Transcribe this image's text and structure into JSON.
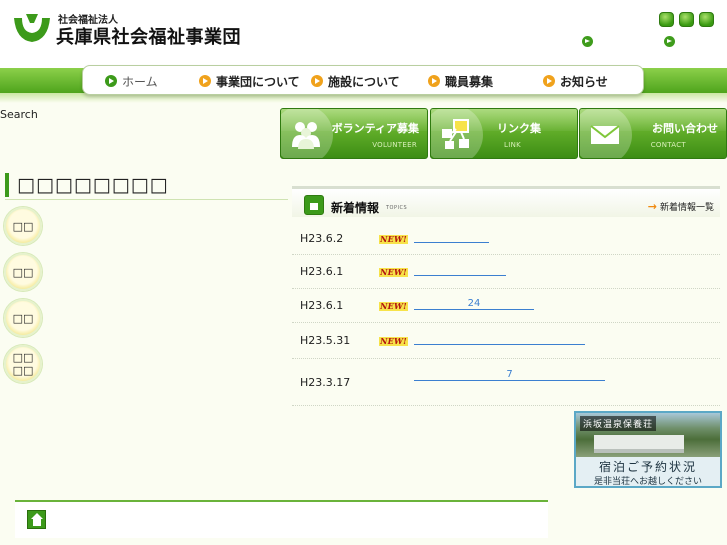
{
  "header": {
    "org_sub": "社会福祉法人",
    "org_name": "兵庫県社会福祉事業団",
    "brand_color": "#3c9a1a"
  },
  "nav": {
    "items": [
      {
        "label": "ホーム",
        "icon": "green-arrow-icon"
      },
      {
        "label": "事業団について",
        "icon": "orange-arrow-icon"
      },
      {
        "label": "施設について",
        "icon": "orange-arrow-icon"
      },
      {
        "label": "職員募集",
        "icon": "orange-arrow-icon"
      },
      {
        "label": "お知らせ",
        "icon": "orange-arrow-icon"
      }
    ]
  },
  "search": {
    "label": "Search"
  },
  "banners": [
    {
      "title": "ボランティア募集",
      "sub": "VOLUNTEER",
      "icon": "people-icon"
    },
    {
      "title": "リンク集",
      "sub": "LINK",
      "icon": "link-icon"
    },
    {
      "title": "お問い合わせ",
      "sub": "CONTACT",
      "icon": "envelope-icon"
    }
  ],
  "left": {
    "heading": "□□□□□□□□",
    "buttons": [
      "□□",
      "□□",
      "□□",
      "□□\n□□"
    ]
  },
  "news": {
    "title": "新着情報",
    "title_en": "TOPICS",
    "list_link": "新着情報一覧",
    "new_label": "NEW!",
    "items": [
      {
        "date": "H23.6.2",
        "is_new": true,
        "link_text": ""
      },
      {
        "date": "H23.6.1",
        "is_new": true,
        "link_text": ""
      },
      {
        "date": "H23.6.1",
        "is_new": true,
        "link_text": "24"
      },
      {
        "date": "H23.5.31",
        "is_new": true,
        "link_text": ""
      },
      {
        "date": "H23.3.17",
        "is_new": false,
        "link_text": "7"
      }
    ]
  },
  "side_banner": {
    "name": "浜坂温泉保養荘",
    "status": "宿泊ご予約状況",
    "note": "是非当荘へお越しください"
  },
  "footer": {
    "home_icon": "home-icon"
  }
}
